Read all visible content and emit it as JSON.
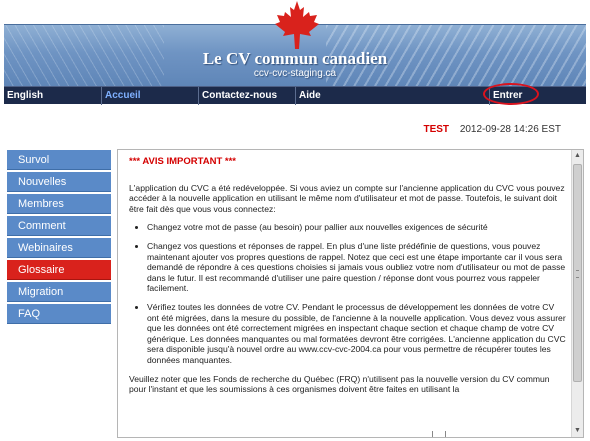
{
  "header": {
    "title": "Le CV commun canadien",
    "subtitle": "ccv-cvc-staging.ca"
  },
  "nav": {
    "items": [
      "English",
      "Accueil",
      "Contactez-nous",
      "Aide",
      "Entrer"
    ],
    "active": "Accueil"
  },
  "status": {
    "env": "TEST",
    "timestamp": "2012-09-28 14:26 EST"
  },
  "sidebar": {
    "items": [
      "Survol",
      "Nouvelles",
      "Membres",
      "Comment",
      "Webinaires",
      "Glossaire",
      "Migration",
      "FAQ"
    ],
    "active": "Glossaire"
  },
  "content": {
    "heading": "*** AVIS IMPORTANT ***",
    "intro": "L'application du CVC a été redéveloppée. Si vous aviez un compte sur l'ancienne application du CVC vous pouvez accéder à la nouvelle application en utilisant le même nom d'utilisateur et mot de passe. Toutefois, le suivant doit être fait dès que vous vous connectez:",
    "bullets": [
      "Changez votre mot de passe (au besoin) pour pallier aux nouvelles exigences de sécurité",
      "Changez vos questions et réponses de rappel. En plus d'une liste prédéfinie de questions, vous pouvez maintenant ajouter vos propres questions de rappel. Notez que ceci est une étape importante car il vous sera demandé de répondre à ces questions choisies si jamais vous oubliez votre nom d'utilisateur ou mot de passe dans le futur. Il est recommandé d'utiliser une paire question / réponse dont vous pourrez vous rappeler facilement.",
      "Vérifiez toutes les données de votre CV. Pendant le processus de développement les données de votre CV ont été migrées, dans la mesure du possible, de l'ancienne à la nouvelle application. Vous devez vous assurer que les données ont été correctement migrées en inspectant chaque section et chaque champ de votre CV générique. Les données manquantes ou mal formatées devront être corrigées. L'ancienne application du CVC sera disponible jusqu'à nouvel ordre au www.ccv-cvc-2004.ca pour vous permettre de récupérer toutes les données manquantes."
    ],
    "footer": "Veuillez noter que les Fonds de recherche du Québec (FRQ) n'utilisent pas la nouvelle version du CV commun pour l'instant et que les soumissions à ces organismes doivent être faites en utilisant la"
  },
  "colors": {
    "nav_bg": "#1c2a4a",
    "sidebar_bg": "#5a8ac8",
    "sidebar_active": "#d9221c",
    "alert_red": "#d40000",
    "annotation_ring": "#d9131e"
  },
  "icons": [
    "maple-leaf-icon",
    "scroll-up-icon",
    "scroll-down-icon"
  ]
}
